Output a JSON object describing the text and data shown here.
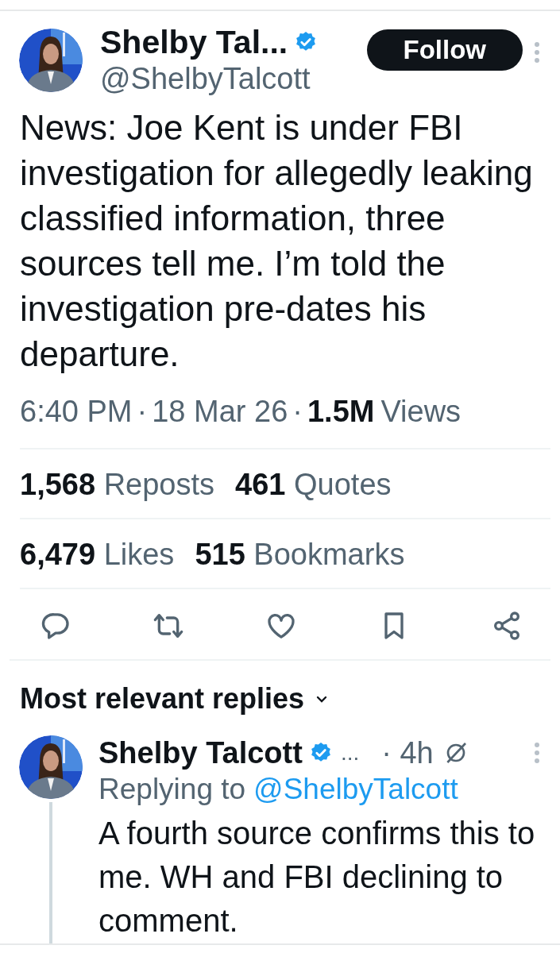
{
  "tweet": {
    "author": {
      "name": "Shelby Tal...",
      "handle": "@ShelbyTalcott",
      "verified": true
    },
    "follow_button": "Follow",
    "text": "News: Joe Kent is under FBI investigation for allegedly leaking classified information, three sources tell me. I’m told the investigation pre-dates his departure.",
    "meta": [
      {
        "kind": "time",
        "text": "6:40 PM"
      },
      {
        "kind": "separator",
        "text": "·"
      },
      {
        "kind": "date",
        "text": "18 Mar 26"
      },
      {
        "kind": "separator",
        "text": "·"
      },
      {
        "kind": "views_count",
        "text": "1.5M"
      },
      {
        "kind": "views_label",
        "text": "Views"
      }
    ],
    "stat_rows": [
      [
        {
          "count": "1,568",
          "label": "Reposts"
        },
        {
          "count": "461",
          "label": "Quotes"
        }
      ],
      [
        {
          "count": "6,479",
          "label": "Likes"
        },
        {
          "count": "515",
          "label": "Bookmarks"
        }
      ]
    ],
    "actions": [
      {
        "kind": "reply"
      },
      {
        "kind": "repost"
      },
      {
        "kind": "like"
      },
      {
        "kind": "bookmark"
      },
      {
        "kind": "share"
      }
    ]
  },
  "replies_sort": {
    "label": "Most relevant replies"
  },
  "replies": [
    {
      "name": "Shelby Talcott",
      "verified": true,
      "ellipsis": "...",
      "age": "· 4h",
      "replying_label": "Replying to",
      "replying_handle": "@ShelbyTalcott",
      "text": "A fourth source confirms this to me. WH and FBI declining to comment."
    }
  ]
}
